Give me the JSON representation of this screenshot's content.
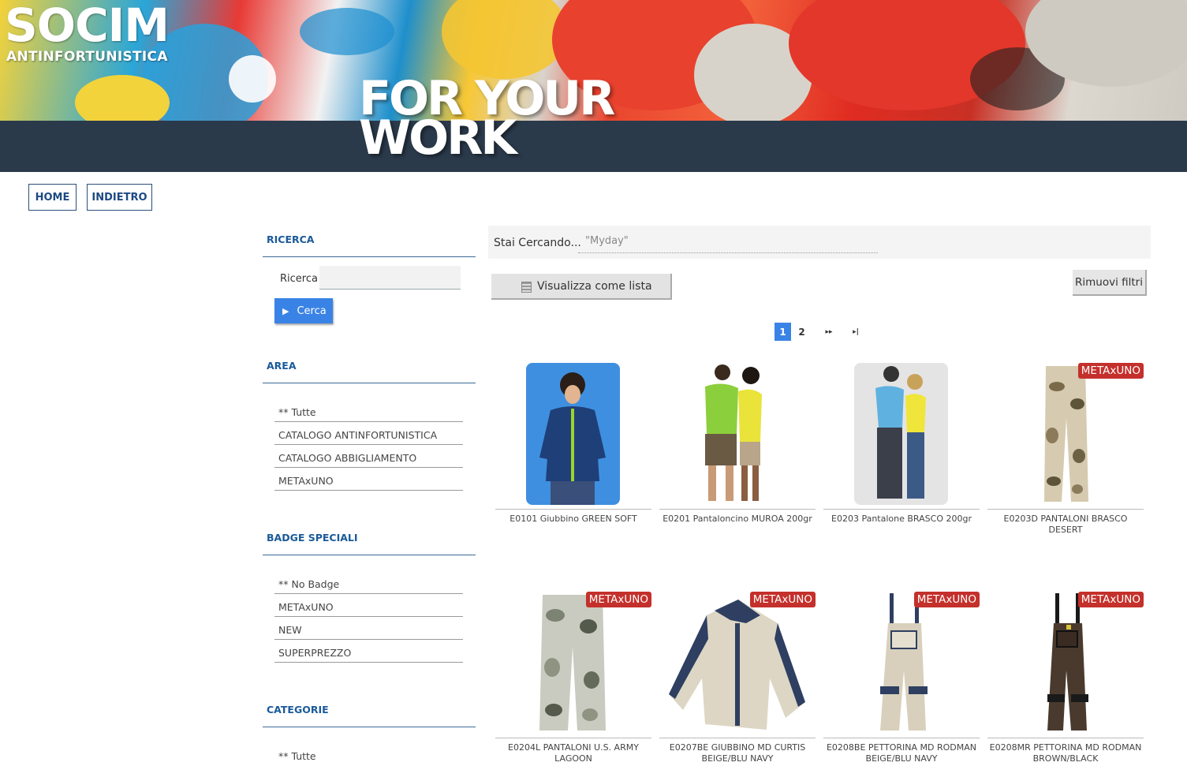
{
  "header": {
    "logo": "SOCIM",
    "logo_sub": "ANTINFORTUNISTICA",
    "slogan_line1": "FOR YOUR",
    "slogan_line2": "WORK"
  },
  "nav": {
    "home": "HOME",
    "back": "INDIETRO"
  },
  "sidebar": {
    "search": {
      "heading": "RICERCA",
      "label": "Ricerca",
      "input_value": "",
      "button": "Cerca"
    },
    "area": {
      "heading": "AREA",
      "items": [
        "** Tutte",
        "CATALOGO ANTINFORTUNISTICA",
        "CATALOGO ABBIGLIAMENTO",
        "METAxUNO"
      ]
    },
    "badges": {
      "heading": "BADGE SPECIALI",
      "items": [
        "** No Badge",
        "METAxUNO",
        "NEW",
        "SUPERPREZZO"
      ]
    },
    "categories": {
      "heading": "CATEGORIE",
      "items": [
        "** Tutte"
      ]
    }
  },
  "main": {
    "searching_label": "Stai Cercando...",
    "searching_value": "\"Myday\"",
    "view_list_button": "Visualizza come lista",
    "remove_filters_button": "Rimuovi filtri",
    "pagination": {
      "pages": [
        "1",
        "2"
      ],
      "current": "1",
      "next": "▸▸",
      "last": "▸|"
    },
    "products": [
      {
        "title": "E0101 Giubbino GREEN SOFT",
        "badge": "",
        "image": "jacket-photo"
      },
      {
        "title": "E0201 Pantaloncino MUROA 200gr",
        "badge": "",
        "image": "couple-shorts-photo"
      },
      {
        "title": "E0203 Pantalone BRASCO 200gr",
        "badge": "",
        "image": "couple-jeans-photo"
      },
      {
        "title": "E0203D PANTALONI BRASCO DESERT",
        "badge": "METAxUNO",
        "image": "camo-trousers-desert"
      },
      {
        "title": "E0204L PANTALONI U.S. ARMY LAGOON",
        "badge": "METAxUNO",
        "image": "camo-trousers-lagoon"
      },
      {
        "title": "E0207BE GIUBBINO MD CURTIS BEIGE/BLU NAVY",
        "badge": "METAxUNO",
        "image": "work-jacket-beige"
      },
      {
        "title": "E0208BE PETTORINA MD RODMAN BEIGE/BLU NAVY",
        "badge": "METAxUNO",
        "image": "bib-overall-beige"
      },
      {
        "title": "E0208MR PETTORINA MD RODMAN BROWN/BLACK",
        "badge": "METAxUNO",
        "image": "bib-overall-brown"
      }
    ]
  }
}
